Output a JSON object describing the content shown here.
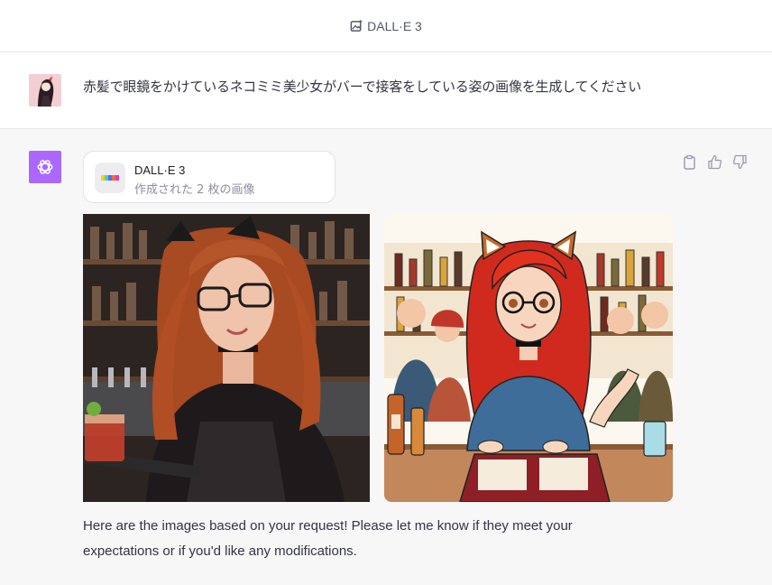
{
  "header": {
    "title": "DALL·E 3",
    "icon": "image-sparkle-icon"
  },
  "user_message": {
    "text": "赤髪で眼鏡をかけているネコミミ美少女がバーで接客をしている姿の画像を生成してください"
  },
  "assistant": {
    "tool_card": {
      "title": "DALL·E 3",
      "subtitle": "作成された 2 枚の画像"
    },
    "images": [
      {
        "style": "photorealistic"
      },
      {
        "style": "anime"
      }
    ],
    "reply_line1": "Here are the images based on your request! Please let me know if they meet your",
    "reply_line2": "expectations or if you'd like any modifications."
  },
  "actions": [
    "clipboard-icon",
    "thumbs-up-icon",
    "thumbs-down-icon"
  ],
  "colors": {
    "bot_avatar": "#ab68ff",
    "background": "#f7f7f8",
    "text": "#343541"
  }
}
